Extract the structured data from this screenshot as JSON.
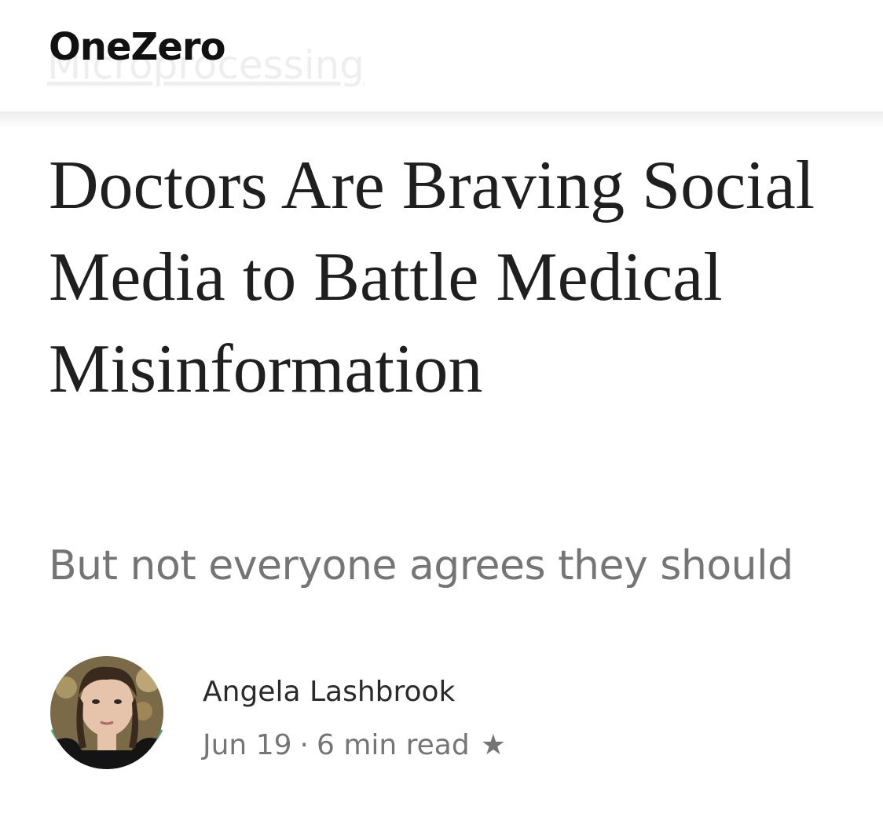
{
  "header": {
    "logo_text": "OneZero",
    "faded_text": "Microprocessing"
  },
  "article": {
    "title": "Doctors Are Braving Social Media to Battle Medical Misinformation",
    "subtitle": "But not everyone agrees they should"
  },
  "author": {
    "name": "Angela Lashbrook",
    "date": "Jun 19",
    "separator": "·",
    "read_time": "6 min read",
    "member_star_icon": "star-icon",
    "ring_color": "#4ea67a"
  }
}
